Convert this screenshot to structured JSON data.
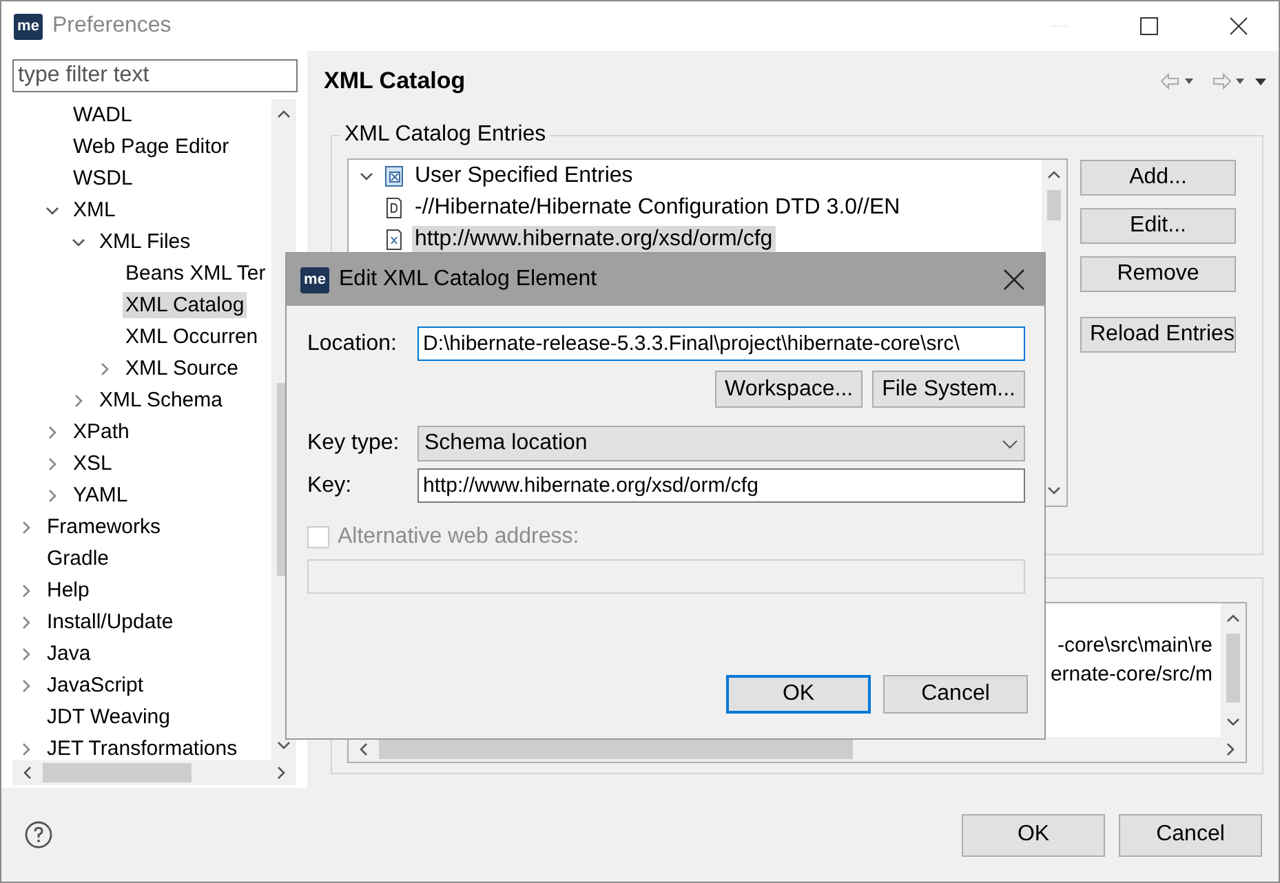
{
  "window": {
    "icon_label": "me",
    "title": "Preferences"
  },
  "sidebar": {
    "filter": {
      "placeholder": "type filter text"
    },
    "tree": {
      "scrolled_group": [
        {
          "label": "WADL",
          "selected": false
        },
        {
          "label": "Web Page Editor",
          "selected": false
        },
        {
          "label": "WSDL",
          "selected": false
        },
        {
          "label": "XML",
          "expanded": true,
          "selected": false,
          "children": [
            {
              "label": "XML Files",
              "expanded": true,
              "selected": false,
              "children": [
                {
                  "label": "Beans XML Ter",
                  "selected": false
                },
                {
                  "label": "XML Catalog",
                  "selected": true
                },
                {
                  "label": "XML Occurren",
                  "selected": false
                },
                {
                  "label": "XML Source",
                  "expanded": false,
                  "selected": false
                }
              ]
            },
            {
              "label": "XML Schema",
              "expanded": false,
              "selected": false
            }
          ]
        },
        {
          "label": "XPath",
          "expanded": false,
          "selected": false
        },
        {
          "label": "XSL",
          "expanded": false,
          "selected": false
        },
        {
          "label": "YAML",
          "expanded": false,
          "selected": false
        }
      ],
      "items": [
        {
          "label": "Frameworks",
          "expanded": false,
          "selected": false
        },
        {
          "label": "Gradle",
          "selected": false
        },
        {
          "label": "Help",
          "expanded": false,
          "selected": false
        },
        {
          "label": "Install/Update",
          "expanded": false,
          "selected": false
        },
        {
          "label": "Java",
          "expanded": false,
          "selected": false
        },
        {
          "label": "JavaScript",
          "expanded": false,
          "selected": false
        },
        {
          "label": "JDT Weaving",
          "selected": false
        },
        {
          "label": "JET Transformations",
          "expanded": false,
          "selected": false
        }
      ]
    }
  },
  "page": {
    "title": "XML Catalog",
    "entries_group": {
      "title": "XML Catalog Entries",
      "entries": [
        {
          "label": "User Specified Entries",
          "kind": "catalog",
          "expanded": true,
          "selected": false,
          "children": [
            {
              "label": "-//Hibernate/Hibernate Configuration DTD 3.0//EN",
              "kind": "dtd",
              "selected": false
            },
            {
              "label": "http://www.hibernate.org/xsd/orm/cfg",
              "kind": "schema",
              "selected": true
            }
          ]
        }
      ],
      "buttons": [
        "Add...",
        "Edit...",
        "Remove",
        "Reload Entries"
      ]
    },
    "details_group": {
      "lines": [
        "-core\\src\\main\\re",
        "ernate-core/src/m"
      ]
    }
  },
  "footer": {
    "buttons": [
      "OK",
      "Cancel"
    ]
  },
  "dialog": {
    "icon_label": "me",
    "title": "Edit XML Catalog Element",
    "location": {
      "label": "Location:",
      "value": "D:\\hibernate-release-5.3.3.Final\\project\\hibernate-core\\src\\"
    },
    "browse_buttons": [
      "Workspace...",
      "File System..."
    ],
    "key_type": {
      "label": "Key type:",
      "value": "Schema location"
    },
    "key": {
      "label": "Key:",
      "value": "http://www.hibernate.org/xsd/orm/cfg"
    },
    "alternative": {
      "label": "Alternative web address:",
      "checked": false,
      "disabled": true
    },
    "buttons": [
      {
        "label": "OK",
        "default": true
      },
      {
        "label": "Cancel",
        "default": false
      }
    ]
  }
}
